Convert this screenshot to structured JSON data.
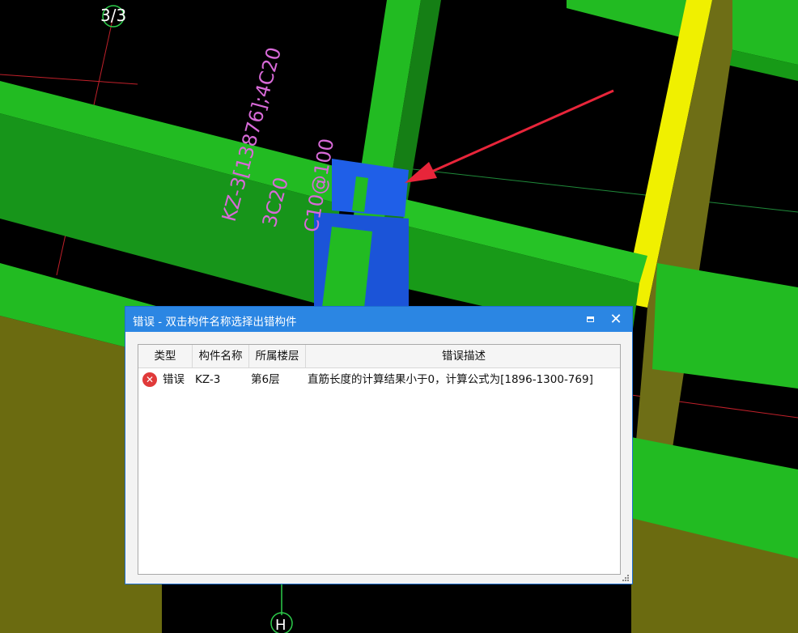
{
  "scene": {
    "top_axis_label": "3/3",
    "bottom_axis_label": "H",
    "member_label": "KZ-3[13876];4C20",
    "rebar_label_1": "3C20",
    "rebar_label_2": "C10@100"
  },
  "dialog": {
    "title": "错误 - 双击构件名称选择出错构件",
    "columns": [
      "类型",
      "构件名称",
      "所属楼层",
      "错误描述"
    ],
    "rows": [
      {
        "icon": "error-circle-icon",
        "type": "错误",
        "name": "KZ-3",
        "floor": "第6层",
        "desc": "直筋长度的计算结果小于0，计算公式为[1896-1300-769]"
      }
    ]
  },
  "colors": {
    "background": "#000000",
    "beam_green": "#22bb22",
    "beam_yellow": "#f0f000",
    "column_blue": "#1f5fe8",
    "arrow_red": "#e8253a",
    "title_bar": "#2b86e3"
  }
}
